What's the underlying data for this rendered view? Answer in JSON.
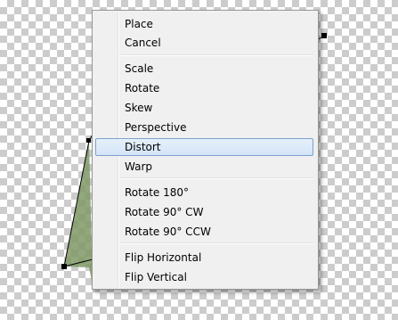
{
  "context_menu": {
    "items": [
      {
        "label": "Place",
        "name": "menu-item-place",
        "highlighted": false
      },
      {
        "label": "Cancel",
        "name": "menu-item-cancel",
        "highlighted": false
      },
      {
        "label": "Scale",
        "name": "menu-item-scale",
        "highlighted": false
      },
      {
        "label": "Rotate",
        "name": "menu-item-rotate",
        "highlighted": false
      },
      {
        "label": "Skew",
        "name": "menu-item-skew",
        "highlighted": false
      },
      {
        "label": "Perspective",
        "name": "menu-item-perspective",
        "highlighted": false
      },
      {
        "label": "Distort",
        "name": "menu-item-distort",
        "highlighted": true
      },
      {
        "label": "Warp",
        "name": "menu-item-warp",
        "highlighted": false
      },
      {
        "label": "Rotate 180°",
        "name": "menu-item-rotate-180",
        "highlighted": false
      },
      {
        "label": "Rotate 90° CW",
        "name": "menu-item-rotate-90-cw",
        "highlighted": false
      },
      {
        "label": "Rotate 90° CCW",
        "name": "menu-item-rotate-90-ccw",
        "highlighted": false
      },
      {
        "label": "Flip Horizontal",
        "name": "menu-item-flip-horizontal",
        "highlighted": false
      },
      {
        "label": "Flip Vertical",
        "name": "menu-item-flip-vertical",
        "highlighted": false
      }
    ]
  },
  "colors": {
    "transparency_checker": "#cccccc",
    "menu_background": "#f0f0f0",
    "highlight_border": "#7da2ce",
    "image_foliage": "#6f8a4f"
  }
}
